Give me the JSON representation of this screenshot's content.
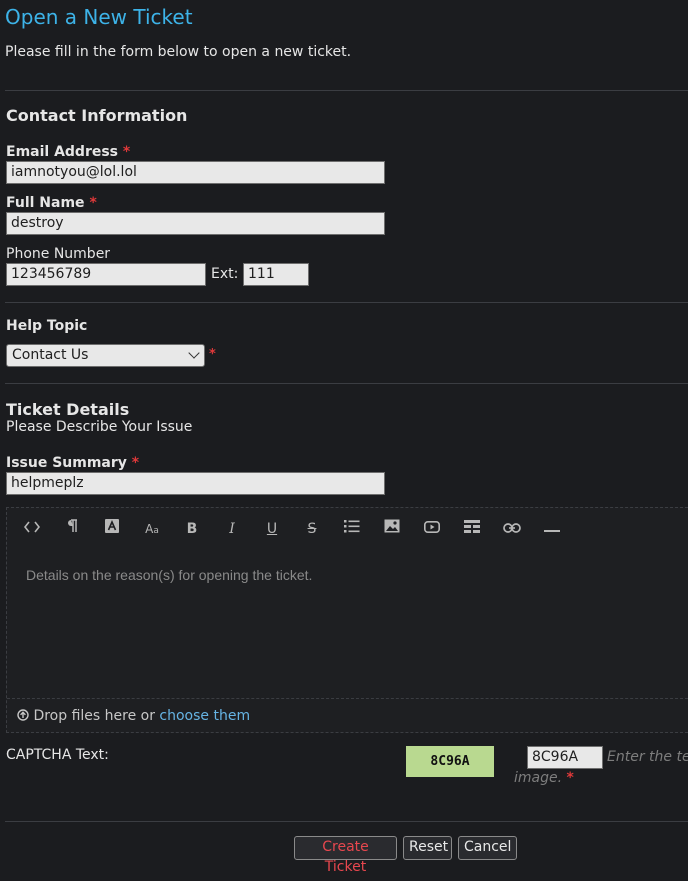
{
  "header": {
    "title": "Open a New Ticket",
    "intro": "Please fill in the form below to open a new ticket."
  },
  "contact": {
    "section_title": "Contact Information",
    "email_label": "Email Address",
    "email_value": "iamnotyou@lol.lol",
    "name_label": "Full Name",
    "name_value": "destroy",
    "phone_label": "Phone Number",
    "phone_value": "123456789",
    "ext_label": "Ext:",
    "ext_value": "111",
    "required_mark": "*"
  },
  "help_topic": {
    "section_title": "Help Topic",
    "selected": "Contact Us",
    "required_mark": "*"
  },
  "ticket": {
    "section_title": "Ticket Details",
    "subtitle": "Please Describe Your Issue",
    "summary_label": "Issue Summary",
    "summary_value": "helpmeplz",
    "required_mark": "*",
    "editor_placeholder": "Details on the reason(s) for opening the ticket.",
    "drop_text": "Drop files here or",
    "drop_link": "choose them",
    "toolbar_icons": [
      "code-view-icon",
      "paragraph-icon",
      "text-color-icon",
      "font-size-icon",
      "bold-icon",
      "italic-icon",
      "underline-icon",
      "strikethrough-icon",
      "bullet-list-icon",
      "image-icon",
      "video-icon",
      "table-icon",
      "link-icon",
      "horizontal-rule-icon"
    ]
  },
  "captcha": {
    "label": "CAPTCHA Text:",
    "image_text": "8C96A",
    "input_value": "8C96A",
    "hint_line1": "Enter the te",
    "hint_line2": "image.",
    "required_mark": "*"
  },
  "actions": {
    "create_label": "Create Ticket",
    "reset_label": "Reset",
    "cancel_label": "Cancel"
  },
  "colors": {
    "background": "#1b1c1f",
    "title": "#3db3e8",
    "required": "#e0393a",
    "link": "#66b4e4"
  }
}
